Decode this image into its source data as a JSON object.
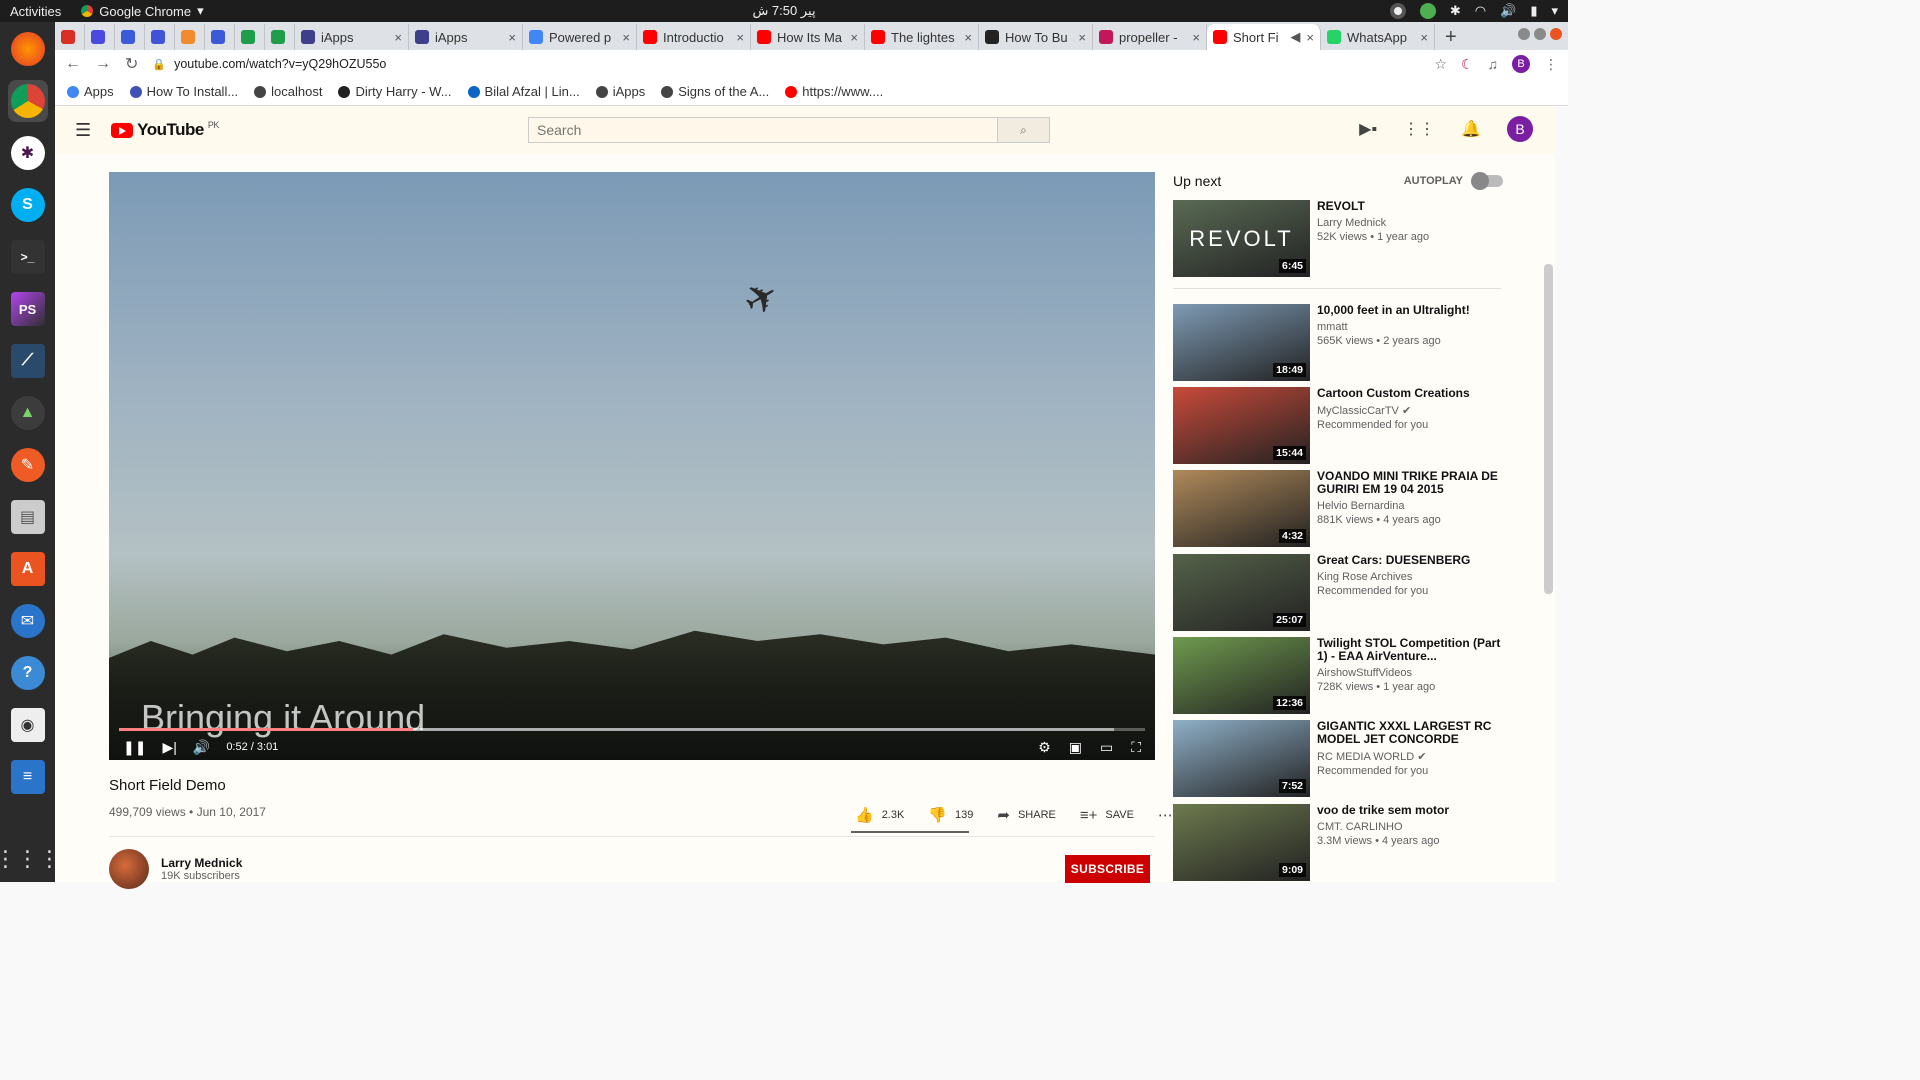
{
  "os": {
    "activities": "Activities",
    "app_name": "Google Chrome",
    "clock": "پیر 7:50 ش"
  },
  "tabs": [
    {
      "title": "",
      "favicon_color": "#d93025"
    },
    {
      "title": "",
      "favicon_color": "#4a4ae0"
    },
    {
      "title": "",
      "favicon_color": "#3b5bdb"
    },
    {
      "title": "",
      "favicon_color": "#4052d6"
    },
    {
      "title": "",
      "favicon_color": "#f28b2d"
    },
    {
      "title": "",
      "favicon_color": "#3c5ad8"
    },
    {
      "title": "",
      "favicon_color": "#1e9e4a"
    },
    {
      "title": "",
      "favicon_color": "#1e9e4a"
    },
    {
      "title": "iApps",
      "favicon_color": "#3e3e8a"
    },
    {
      "title": "iApps",
      "favicon_color": "#3e3e8a"
    },
    {
      "title": "Powered p",
      "favicon_color": "#4285f4"
    },
    {
      "title": "Introductio",
      "favicon_color": "#ff0000"
    },
    {
      "title": "How Its Ma",
      "favicon_color": "#ff0000"
    },
    {
      "title": "The lightes",
      "favicon_color": "#ff0000"
    },
    {
      "title": "How To Bu",
      "favicon_color": "#222222"
    },
    {
      "title": "propeller -",
      "favicon_color": "#c2185b"
    },
    {
      "title": "Short Fi",
      "favicon_color": "#ff0000"
    },
    {
      "title": "WhatsApp",
      "favicon_color": "#25d366"
    }
  ],
  "address": {
    "url": "youtube.com/watch?v=yQ29hOZU55o"
  },
  "bookmarks": [
    {
      "label": "Apps",
      "color": "#4285f4"
    },
    {
      "label": "How To Install...",
      "color": "#3f51b5"
    },
    {
      "label": "localhost",
      "color": "#444444"
    },
    {
      "label": "Dirty Harry - W...",
      "color": "#222222"
    },
    {
      "label": "Bilal Afzal | Lin...",
      "color": "#0a66c2"
    },
    {
      "label": "iApps",
      "color": "#444444"
    },
    {
      "label": "Signs of the A...",
      "color": "#444444"
    },
    {
      "label": "https://www....",
      "color": "#ff0000"
    }
  ],
  "youtube": {
    "logo": "YouTube",
    "region": "PK",
    "search_placeholder": "Search",
    "avatar_letter": "B"
  },
  "player": {
    "caption": "Bringing it Around",
    "time": "0:52 / 3:01",
    "progress_fraction": 0.287,
    "loaded_fraction": 0.97
  },
  "video": {
    "title": "Short Field Demo",
    "meta": "499,709 views • Jun 10, 2017",
    "likes": "2.3K",
    "dislikes": "139",
    "share": "SHARE",
    "save": "SAVE",
    "channel": "Larry Mednick",
    "subscribers": "19K subscribers",
    "subscribe": "SUBSCRIBE"
  },
  "upnext": {
    "label": "Up next",
    "autoplay": "AUTOPLAY",
    "items": [
      {
        "title": "REVOLT",
        "channel": "Larry Mednick",
        "meta": "52K views • 1 year ago",
        "duration": "6:45",
        "overlay": "REVOLT",
        "thumb_color": "#5a6a55"
      },
      {
        "title": "10,000 feet in an Ultralight!",
        "channel": "mmatt",
        "meta": "565K views • 2 years ago",
        "duration": "18:49",
        "overlay": "",
        "thumb_color": "#7e9bb5"
      },
      {
        "title": "Cartoon Custom Creations",
        "channel": "MyClassicCarTV ✔",
        "meta": "Recommended for you",
        "duration": "15:44",
        "overlay": "",
        "thumb_color": "#c94a3a"
      },
      {
        "title": "VOANDO MINI TRIKE PRAIA DE GURIRI EM 19 04 2015",
        "channel": "Helvio Bernardina",
        "meta": "881K views • 4 years ago",
        "duration": "4:32",
        "overlay": "",
        "thumb_color": "#b08a5a"
      },
      {
        "title": "Great Cars: DUESENBERG",
        "channel": "King Rose Archives",
        "meta": "Recommended for you",
        "duration": "25:07",
        "overlay": "",
        "thumb_color": "#55624a"
      },
      {
        "title": "Twilight STOL Competition (Part 1) - EAA AirVenture...",
        "channel": "AirshowStuffVideos",
        "meta": "728K views • 1 year ago",
        "duration": "12:36",
        "overlay": "",
        "thumb_color": "#6f9a4e"
      },
      {
        "title": "GIGANTIC XXXL LARGEST RC MODEL JET CONCORDE SCAL...",
        "channel": "RC MEDIA WORLD ✔",
        "meta": "Recommended for you",
        "duration": "7:52",
        "overlay": "",
        "thumb_color": "#8fb0c8"
      },
      {
        "title": "voo de trike sem motor",
        "channel": "CMT. CARLINHO",
        "meta": "3.3M views • 4 years ago",
        "duration": "9:09",
        "overlay": "",
        "thumb_color": "#6d7a4e"
      }
    ]
  }
}
